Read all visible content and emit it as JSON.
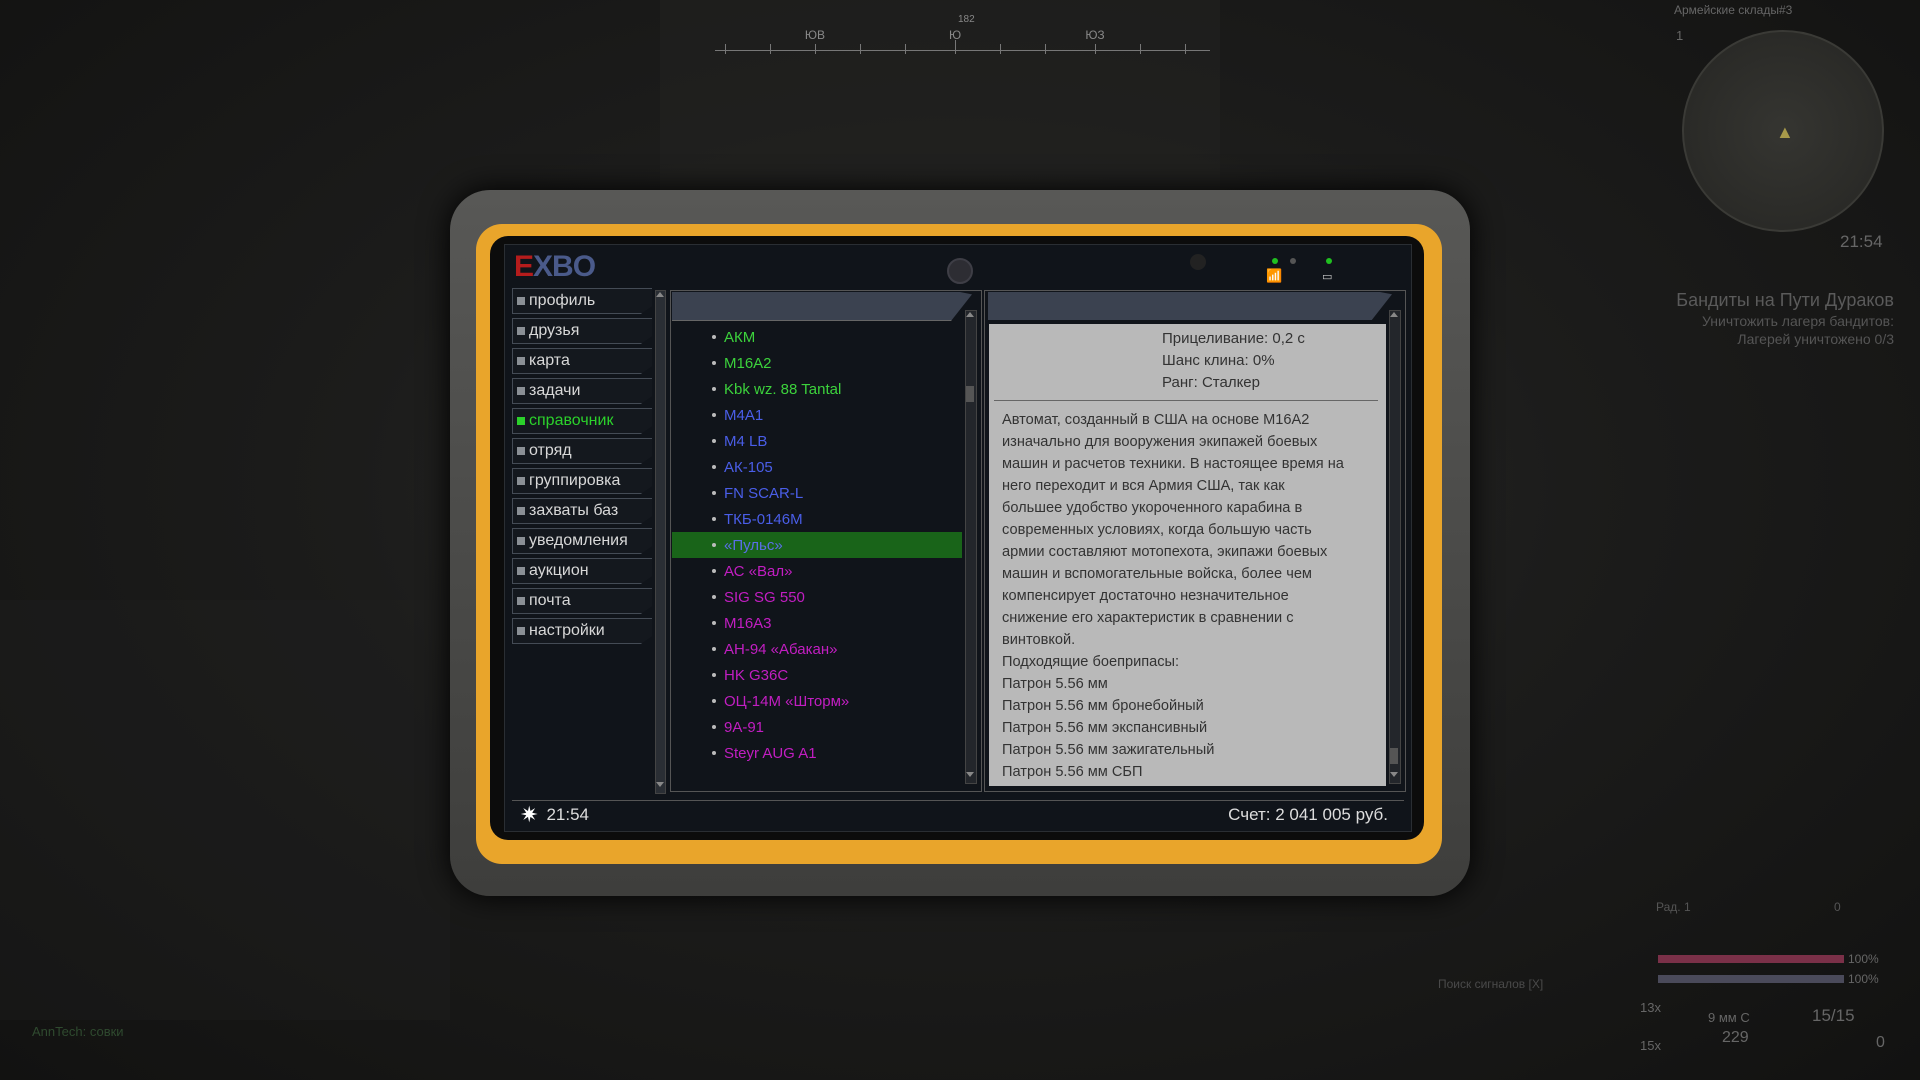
{
  "compass": {
    "labels": [
      "ЮВ",
      "Ю",
      "ЮЗ"
    ],
    "heading": "182"
  },
  "minimap": {
    "title": "Армейские склады#3",
    "number": "1",
    "time": "21:54"
  },
  "quest": {
    "title": "Бандиты на Пути Дураков",
    "objective": "Уничтожить лагеря бандитов:",
    "progress": "Лагерей уничтожено 0/3"
  },
  "hud": {
    "rad_label": "Рад. 1",
    "rad_value": "0",
    "health_pct": "100%",
    "stamina_pct": "100%",
    "signal_search": "Поиск сигналов [X]",
    "ammo_type": "9 мм С",
    "ammo_total": "229",
    "magazine": "15/15",
    "grenades": "0",
    "count_a": "13x",
    "count_b": "15x",
    "health_color": "#c04060",
    "stamina_color": "#6a6a8a"
  },
  "chat": {
    "line": "AnnTech: совки"
  },
  "tablet": {
    "logo_e": "E",
    "logo_rest": "XBO",
    "sidebar": [
      {
        "label": "профиль"
      },
      {
        "label": "друзья"
      },
      {
        "label": "карта"
      },
      {
        "label": "задачи"
      },
      {
        "label": "справочник",
        "active": true
      },
      {
        "label": "отряд"
      },
      {
        "label": "группировка"
      },
      {
        "label": "захваты баз"
      },
      {
        "label": "уведомления"
      },
      {
        "label": "аукцион"
      },
      {
        "label": "почта"
      },
      {
        "label": "настройки"
      }
    ],
    "list": [
      {
        "name": "АКМ",
        "color": "#3cd23c"
      },
      {
        "name": "M16A2",
        "color": "#3cd23c"
      },
      {
        "name": "Kbk wz. 88 Tantal",
        "color": "#3cd23c"
      },
      {
        "name": "M4A1",
        "color": "#4a5ee8"
      },
      {
        "name": "M4 LB",
        "color": "#4a5ee8"
      },
      {
        "name": "АК-105",
        "color": "#4a5ee8"
      },
      {
        "name": "FN SCAR-L",
        "color": "#4a5ee8"
      },
      {
        "name": "ТКБ-0146М",
        "color": "#4a5ee8"
      },
      {
        "name": "«Пульс»",
        "color": "#5a6ee8",
        "selected": true
      },
      {
        "name": "АС «Вал»",
        "color": "#c21ec2"
      },
      {
        "name": "SIG SG 550",
        "color": "#c21ec2"
      },
      {
        "name": "M16A3",
        "color": "#c21ec2"
      },
      {
        "name": "АН-94 «Абакан»",
        "color": "#c21ec2"
      },
      {
        "name": "HK G36C",
        "color": "#c21ec2"
      },
      {
        "name": "ОЦ-14М «Шторм»",
        "color": "#c21ec2"
      },
      {
        "name": "9А-91",
        "color": "#c21ec2"
      },
      {
        "name": "Steyr AUG A1",
        "color": "#c21ec2"
      }
    ],
    "detail": {
      "stats": [
        "Прицеливание: 0,2 с",
        "Шанс клина: 0%",
        "Ранг: Сталкер"
      ],
      "lines": [
        "Автомат, созданный в США на основе M16A2",
        "изначально для вооружения экипажей боевых",
        "машин и расчетов техники. В настоящее время на",
        "него переходит и вся Армия США, так как",
        "большее удобство укороченного карабина в",
        "современных условиях, когда большую часть",
        "армии составляют мотопехота, экипажи боевых",
        "машин и вспомогательные войска, более чем",
        "компенсирует достаточно незначительное",
        "снижение его характеристик в сравнении с",
        "винтовкой.",
        "Подходящие боеприпасы:",
        "Патрон 5.56 мм",
        "Патрон 5.56 мм бронебойный",
        "Патрон 5.56 мм экспансивный",
        "Патрон 5.56 мм зажигательный",
        "Патрон 5.56 мм СБП"
      ]
    },
    "footer": {
      "time": "21:54",
      "balance": "Счет: 2 041 005 руб."
    }
  }
}
